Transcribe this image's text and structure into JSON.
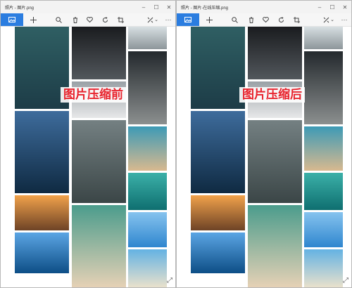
{
  "windows": [
    {
      "title": "照片 - 图片.png",
      "caption": "图片压缩前",
      "toolbar": {
        "crop_label": "⌗",
        "more_label": "···",
        "dropdown_label": "⌄"
      },
      "controls": {
        "minimize": "–",
        "maximize": "☐",
        "close": "✕"
      },
      "icons": [
        "gallery-icon",
        "add-icon",
        "zoom-icon",
        "delete-icon",
        "favorite-icon",
        "rotate-icon",
        "crop-icon",
        "edit-icon",
        "more-icon"
      ]
    },
    {
      "title": "照片 - 图片-在线压缩.png",
      "caption": "图片压缩后",
      "toolbar": {
        "crop_label": "⌗",
        "more_label": "···",
        "dropdown_label": "⌄"
      },
      "controls": {
        "minimize": "–",
        "maximize": "☐",
        "close": "✕"
      },
      "icons": [
        "gallery-icon",
        "add-icon",
        "zoom-icon",
        "delete-icon",
        "favorite-icon",
        "rotate-icon",
        "crop-icon",
        "edit-icon",
        "more-icon"
      ]
    }
  ],
  "colors": {
    "accent": "#2b7de0",
    "caption": "#e8232d"
  },
  "photos": [
    {
      "name": "ocean-wave-photo",
      "top": "#2f5f63",
      "bottom": "#1d3c47"
    },
    {
      "name": "ocean-sunset-sailboat-photo",
      "top": "#3e6c9c",
      "bottom": "#0f2a42"
    },
    {
      "name": "sunset-horizon-photo",
      "top": "#f1a24b",
      "bottom": "#6e4326"
    },
    {
      "name": "sailboat-blue-sea-photo",
      "top": "#5ba5e4",
      "bottom": "#0d4e86"
    },
    {
      "name": "dark-waves-photo",
      "top": "#1a1c1f",
      "bottom": "#52575c"
    },
    {
      "name": "misty-sea-photo",
      "top": "#9aa1a6",
      "bottom": "#e7e8e9"
    },
    {
      "name": "grey-ocean-photo",
      "top": "#748082",
      "bottom": "#3b4647"
    },
    {
      "name": "aerial-beach-photo",
      "top": "#4b9c8c",
      "bottom": "#e8d2b6"
    },
    {
      "name": "white-waves-photo",
      "top": "#d7dfe2",
      "bottom": "#8d969a"
    },
    {
      "name": "rocky-shore-photo",
      "top": "#23292d",
      "bottom": "#8b8f8f"
    },
    {
      "name": "beach-shore-photo",
      "top": "#3d9ab6",
      "bottom": "#d8b98f"
    },
    {
      "name": "turquoise-water-photo",
      "top": "#3bb0a8",
      "bottom": "#0f6f70"
    },
    {
      "name": "sky-sea-photo",
      "top": "#86c3ee",
      "bottom": "#2f86cf"
    },
    {
      "name": "palm-beach-photo",
      "top": "#64b2e3",
      "bottom": "#e9e1cc"
    }
  ]
}
